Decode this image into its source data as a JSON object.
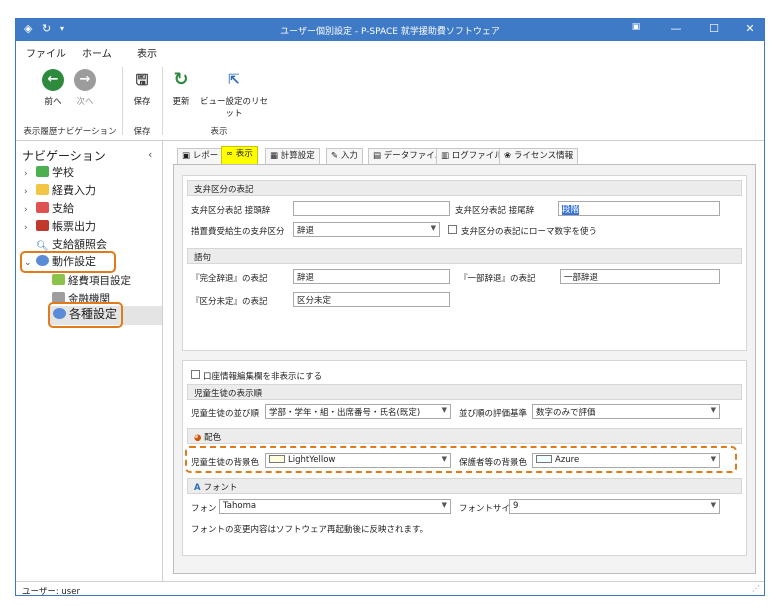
{
  "window": {
    "title": "ユーザー個別設定 - P-SPACE 就学援助費ソフトウェア"
  },
  "menu": {
    "file": "ファイル",
    "home": "ホーム",
    "view": "表示"
  },
  "ribbon": {
    "back": "前へ",
    "next": "次へ",
    "save": "保存",
    "refresh": "更新",
    "reset_view": "ビュー設定のリセット",
    "group_nav": "表示履歴ナビゲーション",
    "group_save": "保存",
    "group_view": "表示"
  },
  "nav": {
    "title": "ナビゲーション",
    "items": [
      "学校",
      "経費入力",
      "支給",
      "帳票出力",
      "支給額照会",
      "動作設定"
    ],
    "subitems": [
      "経費項目設定",
      "金融機関",
      "各種設定"
    ]
  },
  "tabs": [
    "レポート",
    "表示",
    "計算設定",
    "入力",
    "データファイル",
    "ログファイル",
    "ライセンス情報"
  ],
  "settings": {
    "sec_branch": "支弁区分の表記",
    "prefix_label": "支弁区分表記 接頭辞",
    "prefix_value": "",
    "suffix_label": "支弁区分表記 接尾辞",
    "suffix_value": "段階",
    "measure_label": "措置費受給生の支弁区分",
    "measure_value": "辞退",
    "roman_label": "支弁区分の表記にローマ数字を使う",
    "sec_phrase": "語句",
    "full_label": "『完全辞退』の表記",
    "full_value": "辞退",
    "partial_label": "『一部辞退』の表記",
    "partial_value": "一部辞退",
    "undef_label": "『区分未定』の表記",
    "undef_value": "区分未定",
    "hide_account_label": "口座情報編集欄を非表示にする",
    "sec_order": "児童生徒の表示順",
    "order_label": "児童生徒の並び順",
    "order_value": "学部・学年・組・出席番号・氏名(既定)",
    "criteria_label": "並び順の評価基準",
    "criteria_value": "数字のみで評価",
    "sec_color": "配色",
    "student_bg_label": "児童生徒の背景色",
    "student_bg_value": "LightYellow",
    "student_bg_color": "#ffffe0",
    "guardian_bg_label": "保護者等の背景色",
    "guardian_bg_value": "Azure",
    "guardian_bg_color": "#f0ffff",
    "sec_font": "フォント",
    "font_label": "フォント",
    "font_value": "Tahoma",
    "fontsize_label": "フォントサイズ",
    "fontsize_value": "9",
    "font_note": "フォントの変更内容はソフトウェア再起動後に反映されます。"
  },
  "status": {
    "user": "ユーザー: user"
  }
}
